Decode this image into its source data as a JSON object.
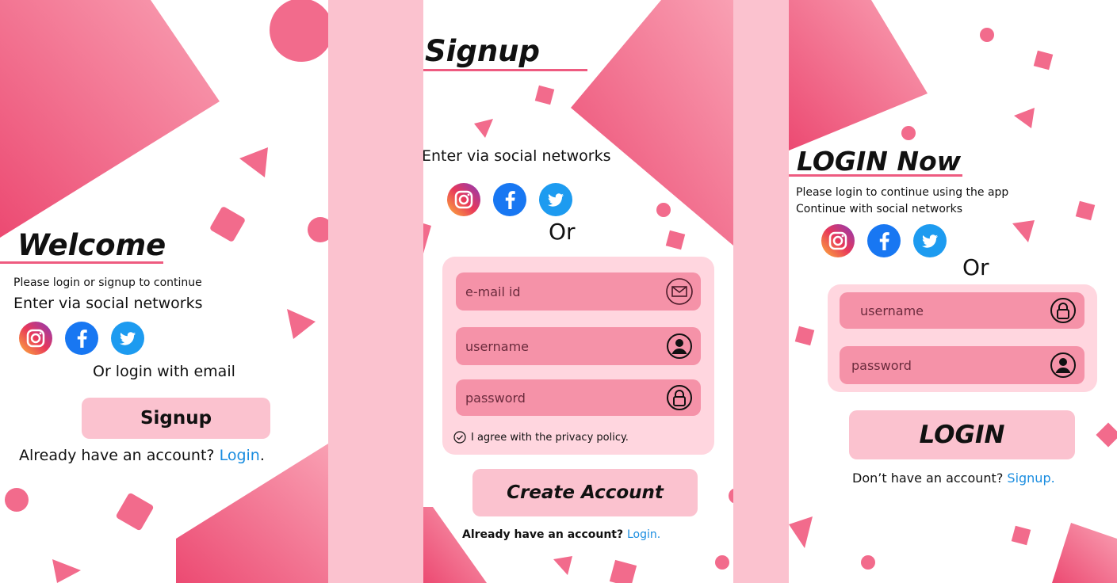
{
  "colors": {
    "accent": "#ee5b80",
    "strip": "#fbc2cf",
    "field": "#f592a8",
    "card": "#ffd6df",
    "link": "#1a8de0"
  },
  "welcome": {
    "title": "Welcome",
    "subtitle": "Please login or signup to continue",
    "social_heading": "Enter via social networks",
    "social": [
      "instagram-icon",
      "facebook-icon",
      "twitter-icon"
    ],
    "or_text": "Or login with email",
    "signup_button": "Signup",
    "footer_text": "Already have an account?",
    "footer_link": "Login",
    "footer_period": "."
  },
  "signup": {
    "title": "Signup",
    "social_heading": "Enter via social networks",
    "or_text": "Or",
    "email_placeholder": "e-mail id",
    "username_placeholder": "username",
    "password_placeholder": "password",
    "agree_text": "I agree with the privacy policy.",
    "create_button": "Create Account",
    "footer_text": "Already have an account?",
    "footer_link": "Login."
  },
  "login": {
    "title": "LOGIN Now",
    "subtitle": "Please login to continue using the app",
    "social_heading": "Continue with social networks",
    "or_text": "Or",
    "username_placeholder": "username",
    "password_placeholder": "password",
    "login_button": "LOGIN",
    "footer_text": "Don’t have an account?",
    "footer_link": "Signup."
  }
}
